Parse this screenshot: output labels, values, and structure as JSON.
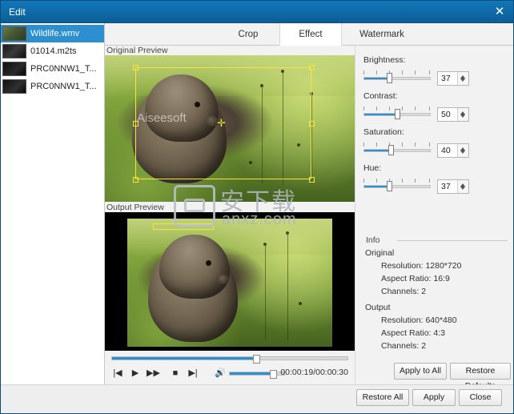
{
  "window": {
    "title": "Edit",
    "close_icon": "close-icon"
  },
  "filelist": {
    "items": [
      {
        "name": "Wildlife.wmv",
        "selected": true
      },
      {
        "name": "01014.m2ts",
        "selected": false
      },
      {
        "name": "PRC0NNW1_T...",
        "selected": false
      },
      {
        "name": "PRC0NNW1_T...",
        "selected": false
      }
    ]
  },
  "tabs": [
    {
      "label": "Crop",
      "active": false
    },
    {
      "label": "Effect",
      "active": true
    },
    {
      "label": "Watermark",
      "active": false
    }
  ],
  "previews": {
    "original_label": "Original Preview",
    "output_label": "Output Preview"
  },
  "watermark": {
    "cn_text": "安下载",
    "url_text": "anxz.com",
    "brand": "Aiseesoft"
  },
  "transport": {
    "prev_icon": "skip-previous-icon",
    "play_icon": "play-icon",
    "forward_icon": "fast-forward-icon",
    "stop_icon": "stop-icon",
    "next_icon": "skip-next-icon",
    "volume_icon": "volume-icon",
    "timecode": "00:00:19/00:00:30",
    "seek_percent": 62,
    "volume_percent": 78
  },
  "effects": {
    "sliders": [
      {
        "label": "Brightness:",
        "value": "37",
        "percent": 37
      },
      {
        "label": "Contrast:",
        "value": "50",
        "percent": 50
      },
      {
        "label": "Saturation:",
        "value": "40",
        "percent": 40
      },
      {
        "label": "Hue:",
        "value": "37",
        "percent": 37
      }
    ]
  },
  "info": {
    "legend": "Info",
    "original_head": "Original",
    "original": [
      "Resolution: 1280*720",
      "Aspect Ratio: 16:9",
      "Channels: 2"
    ],
    "output_head": "Output",
    "output": [
      "Resolution: 640*480",
      "Aspect Ratio: 4:3",
      "Channels: 2"
    ]
  },
  "buttons": {
    "apply_to_all": "Apply to All",
    "restore_defaults": "Restore Defaults",
    "restore_all": "Restore All",
    "apply": "Apply",
    "close": "Close"
  },
  "colors": {
    "titlebar": "#0f6ba8",
    "accent": "#2d8fd0",
    "crop_outline": "#f5e63d",
    "selection": "#2d8fd0"
  }
}
